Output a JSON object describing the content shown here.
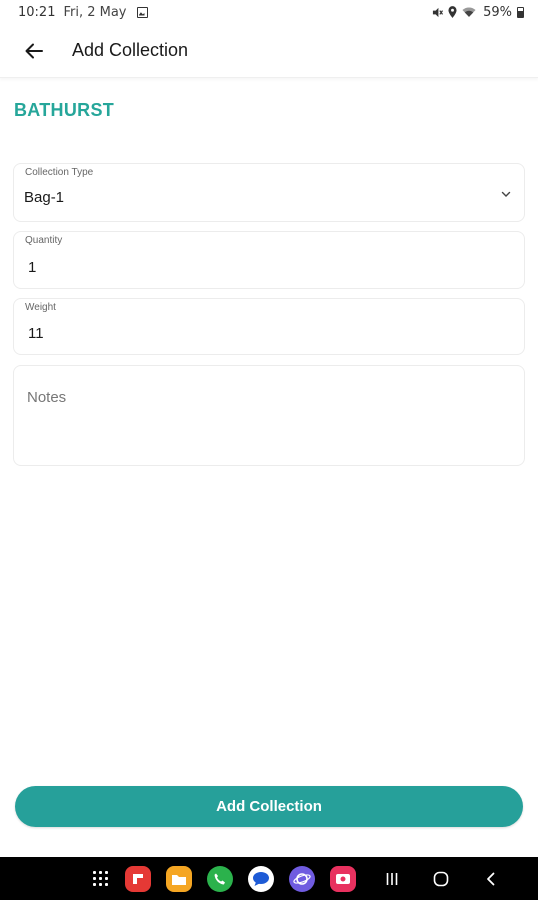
{
  "status_bar": {
    "time": "10:21",
    "date": "Fri, 2 May",
    "battery": "59%",
    "icons": [
      "gallery-icon",
      "mute-icon",
      "location-icon",
      "wifi-icon",
      "battery-icon"
    ]
  },
  "header": {
    "title": "Add Collection",
    "back_icon": "arrow-left-icon"
  },
  "location_name": "BATHURST",
  "form": {
    "collection_type": {
      "label": "Collection Type",
      "value": "Bag-1"
    },
    "quantity": {
      "label": "Quantity",
      "value": "1"
    },
    "weight": {
      "label": "Weight",
      "value": "11"
    },
    "notes": {
      "placeholder": "Notes",
      "value": ""
    }
  },
  "submit_label": "Add Collection",
  "nav_bar": {
    "apps": [
      "apps-grid-icon",
      "flipboard-icon",
      "files-icon",
      "phone-icon",
      "messages-icon",
      "internet-icon",
      "screen-recorder-icon"
    ],
    "buttons": [
      "recents-icon",
      "home-icon",
      "back-icon"
    ]
  },
  "colors": {
    "accent": "#26a69a",
    "button": "#26a09a",
    "nav_bar": "#000000"
  }
}
